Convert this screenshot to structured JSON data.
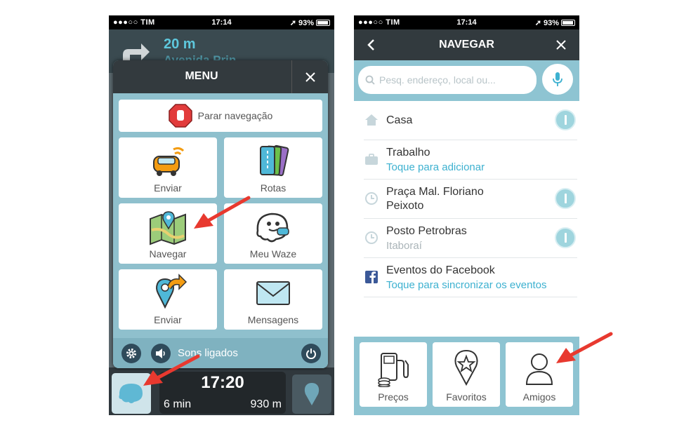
{
  "colors": {
    "accent_blue": "#3db1d0",
    "panel_teal": "#8fc0cd",
    "header_dark": "#333a3e",
    "arrow_red": "#e8392f"
  },
  "left_phone": {
    "status": {
      "carrier": "TIM",
      "time": "17:14",
      "battery": "93%"
    },
    "nav": {
      "distance": "20 m",
      "street": "Avenida Prin..."
    },
    "menu": {
      "title": "MENU",
      "stop_navigation": "Parar navegação",
      "tiles": [
        {
          "label": "Enviar",
          "icon": "car-icon"
        },
        {
          "label": "Rotas",
          "icon": "cards-icon"
        },
        {
          "label": "Navegar",
          "icon": "map-icon"
        },
        {
          "label": "Meu Waze",
          "icon": "waze-ghost-icon"
        },
        {
          "label": "Enviar",
          "icon": "share-location-icon"
        },
        {
          "label": "Mensagens",
          "icon": "envelope-icon"
        }
      ],
      "sound_label": "Sons ligados"
    },
    "eta": {
      "time": "17:20",
      "minutes": "6 min",
      "distance": "930 m"
    }
  },
  "right_phone": {
    "status": {
      "carrier": "TIM",
      "time": "17:14",
      "battery": "93%"
    },
    "title": "NAVEGAR",
    "search": {
      "placeholder": "Pesq. endereço, local ou..."
    },
    "items": [
      {
        "title": "Casa",
        "subtitle": "",
        "icon": "home-icon"
      },
      {
        "title": "Trabalho",
        "subtitle": "Toque para adicionar",
        "icon": "briefcase-icon"
      },
      {
        "title": "Praça Mal. Floriano",
        "title2": "Peixoto",
        "subtitle": "",
        "icon": "clock-icon"
      },
      {
        "title": "Posto Petrobras",
        "subtitle": "Itaboraí",
        "icon": "clock-icon"
      },
      {
        "title": "Eventos do Facebook",
        "subtitle": "Toque para sincronizar os eventos",
        "icon": "facebook-icon"
      }
    ],
    "categories": [
      {
        "label": "Preços",
        "icon": "fuel-pump-icon"
      },
      {
        "label": "Favoritos",
        "icon": "star-pin-icon"
      },
      {
        "label": "Amigos",
        "icon": "person-icon"
      }
    ]
  }
}
